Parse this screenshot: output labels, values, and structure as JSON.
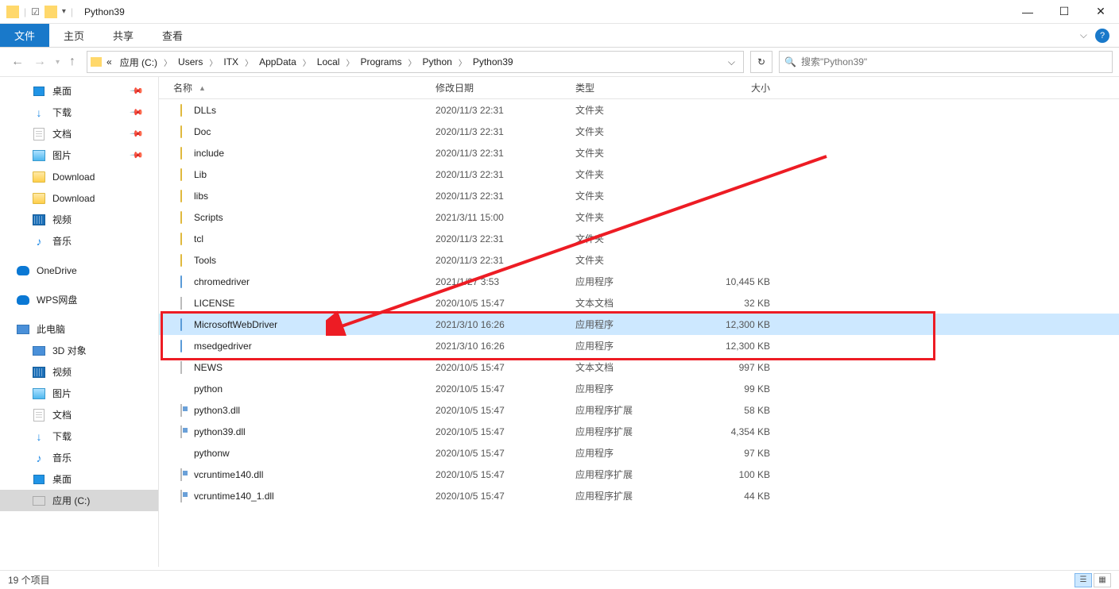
{
  "window": {
    "title": "Python39"
  },
  "ribbon": {
    "file": "文件",
    "tabs": [
      "主页",
      "共享",
      "查看"
    ]
  },
  "breadcrumbs": [
    "«",
    "应用 (C:)",
    "Users",
    "ITX",
    "AppData",
    "Local",
    "Programs",
    "Python",
    "Python39"
  ],
  "search": {
    "placeholder": "搜索\"Python39\""
  },
  "columns": {
    "name": "名称",
    "date": "修改日期",
    "type": "类型",
    "size": "大小"
  },
  "sidebar": [
    {
      "label": "桌面",
      "icon": "desktop",
      "pinned": true
    },
    {
      "label": "下载",
      "icon": "dl",
      "pinned": true
    },
    {
      "label": "文档",
      "icon": "file",
      "pinned": true
    },
    {
      "label": "图片",
      "icon": "pic",
      "pinned": true
    },
    {
      "label": "Download",
      "icon": "folder"
    },
    {
      "label": "Download",
      "icon": "folder"
    },
    {
      "label": "视频",
      "icon": "vid"
    },
    {
      "label": "音乐",
      "icon": "music"
    },
    {
      "label": "OneDrive",
      "icon": "cloud",
      "lvl": 1,
      "gap": true
    },
    {
      "label": "WPS网盘",
      "icon": "cloud",
      "lvl": 1,
      "gap": true
    },
    {
      "label": "此电脑",
      "icon": "pc",
      "lvl": 1,
      "gap": true
    },
    {
      "label": "3D 对象",
      "icon": "pc"
    },
    {
      "label": "视频",
      "icon": "vid"
    },
    {
      "label": "图片",
      "icon": "pic"
    },
    {
      "label": "文档",
      "icon": "file"
    },
    {
      "label": "下载",
      "icon": "dl"
    },
    {
      "label": "音乐",
      "icon": "music"
    },
    {
      "label": "桌面",
      "icon": "desktop"
    },
    {
      "label": "应用 (C:)",
      "icon": "disk",
      "sel": true
    }
  ],
  "files": [
    {
      "name": "DLLs",
      "date": "2020/11/3 22:31",
      "type": "文件夹",
      "size": "",
      "icon": "folder"
    },
    {
      "name": "Doc",
      "date": "2020/11/3 22:31",
      "type": "文件夹",
      "size": "",
      "icon": "folder"
    },
    {
      "name": "include",
      "date": "2020/11/3 22:31",
      "type": "文件夹",
      "size": "",
      "icon": "folder"
    },
    {
      "name": "Lib",
      "date": "2020/11/3 22:31",
      "type": "文件夹",
      "size": "",
      "icon": "folder"
    },
    {
      "name": "libs",
      "date": "2020/11/3 22:31",
      "type": "文件夹",
      "size": "",
      "icon": "folder"
    },
    {
      "name": "Scripts",
      "date": "2021/3/11 15:00",
      "type": "文件夹",
      "size": "",
      "icon": "folder"
    },
    {
      "name": "tcl",
      "date": "2020/11/3 22:31",
      "type": "文件夹",
      "size": "",
      "icon": "folder"
    },
    {
      "name": "Tools",
      "date": "2020/11/3 22:31",
      "type": "文件夹",
      "size": "",
      "icon": "folder"
    },
    {
      "name": "chromedriver",
      "date": "2021/1/27 3:53",
      "type": "应用程序",
      "size": "10,445 KB",
      "icon": "exe"
    },
    {
      "name": "LICENSE",
      "date": "2020/10/5 15:47",
      "type": "文本文档",
      "size": "32 KB",
      "icon": "file"
    },
    {
      "name": "MicrosoftWebDriver",
      "date": "2021/3/10 16:26",
      "type": "应用程序",
      "size": "12,300 KB",
      "icon": "exe",
      "sel": true
    },
    {
      "name": "msedgedriver",
      "date": "2021/3/10 16:26",
      "type": "应用程序",
      "size": "12,300 KB",
      "icon": "exe"
    },
    {
      "name": "NEWS",
      "date": "2020/10/5 15:47",
      "type": "文本文档",
      "size": "997 KB",
      "icon": "file"
    },
    {
      "name": "python",
      "date": "2020/10/5 15:47",
      "type": "应用程序",
      "size": "99 KB",
      "icon": "py"
    },
    {
      "name": "python3.dll",
      "date": "2020/10/5 15:47",
      "type": "应用程序扩展",
      "size": "58 KB",
      "icon": "dll"
    },
    {
      "name": "python39.dll",
      "date": "2020/10/5 15:47",
      "type": "应用程序扩展",
      "size": "4,354 KB",
      "icon": "dll"
    },
    {
      "name": "pythonw",
      "date": "2020/10/5 15:47",
      "type": "应用程序",
      "size": "97 KB",
      "icon": "py"
    },
    {
      "name": "vcruntime140.dll",
      "date": "2020/10/5 15:47",
      "type": "应用程序扩展",
      "size": "100 KB",
      "icon": "dll"
    },
    {
      "name": "vcruntime140_1.dll",
      "date": "2020/10/5 15:47",
      "type": "应用程序扩展",
      "size": "44 KB",
      "icon": "dll"
    }
  ],
  "status": {
    "count": "19 个项目"
  }
}
